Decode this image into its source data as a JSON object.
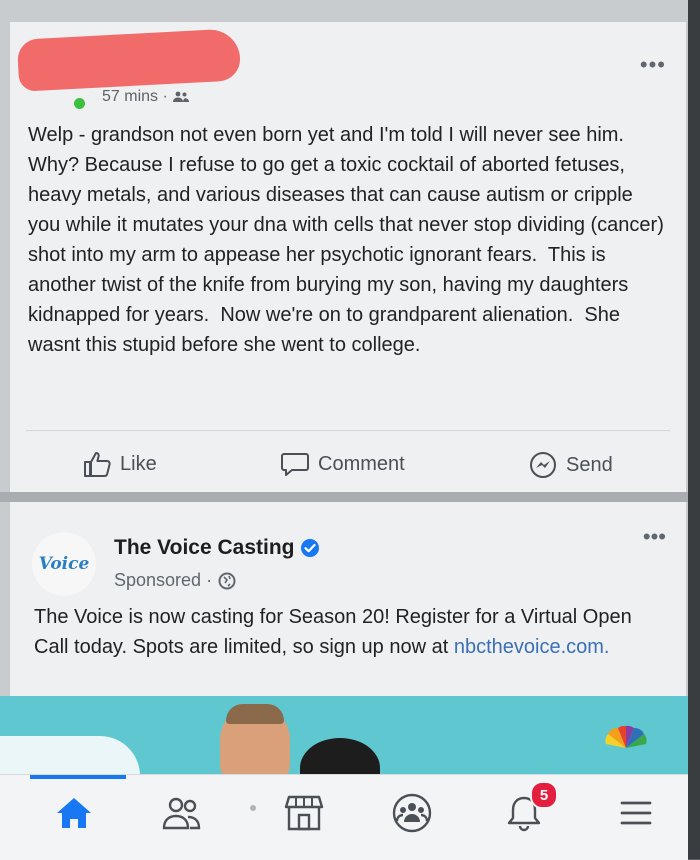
{
  "post": {
    "time": "57 mins ·",
    "privacy_icon": "friends-icon",
    "text": "Welp - grandson not even born yet and I'm told I will never see him.  Why? Because I refuse to go get a toxic cocktail of aborted fetuses, heavy metals, and various diseases that can cause autism or cripple you while it mutates your dna with cells that never stop dividing (cancer) shot into my arm to appease her psychotic ignorant fears.  This is another twist of the knife from burying my son, having my daughters kidnapped for years.  Now we're on to grandparent alienation.  She wasnt this stupid before she went to college.",
    "more": "•••",
    "actions": {
      "like": "Like",
      "comment": "Comment",
      "send": "Send"
    }
  },
  "ad": {
    "logo": "Voice",
    "page_name": "The Voice Casting",
    "sponsored": "Sponsored ·",
    "more": "•••",
    "text": "The Voice is now casting for Season 20! Register for a Virtual Open Call today. Spots are limited, so sign up now at ",
    "link": "nbcthevoice.com."
  },
  "navbar": {
    "notifications_count": "5",
    "items": [
      "home-icon",
      "friends-icon",
      "marketplace-icon",
      "groups-icon",
      "bell-icon",
      "menu-icon"
    ]
  },
  "colors": {
    "accent": "#1877f2",
    "badge": "#e41e3f",
    "link": "#3b6fb6",
    "online": "#3fbf3f"
  }
}
